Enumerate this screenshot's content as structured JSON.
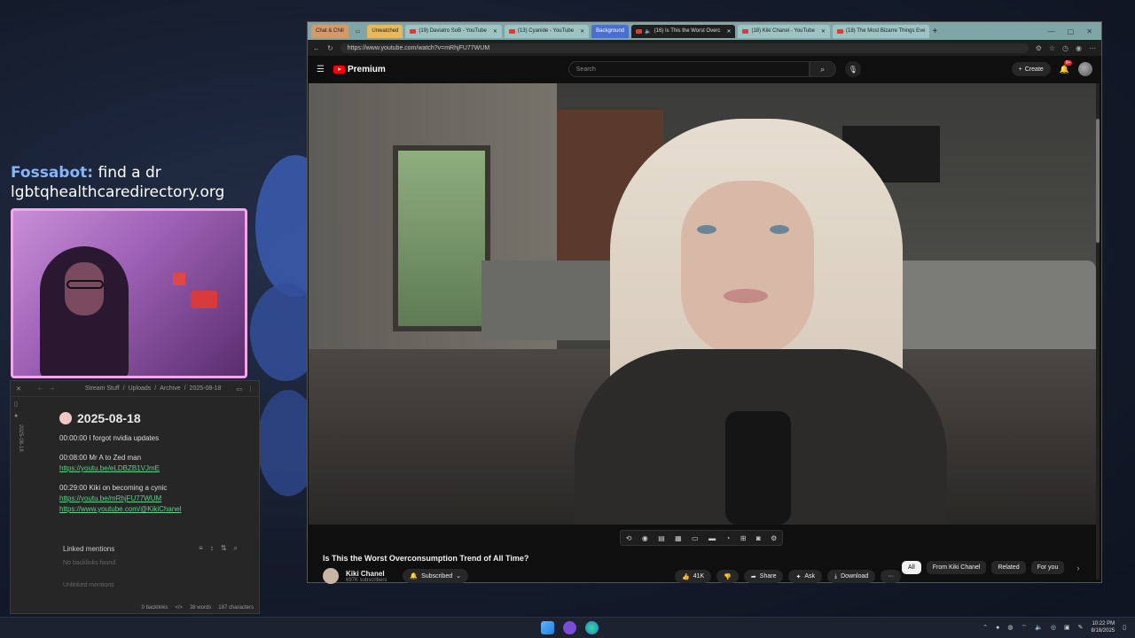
{
  "overlay": {
    "chat_user": "Fossabot:",
    "chat_message": "find a dr",
    "chat_link": "lgbtqhealthcaredirectory.org"
  },
  "obsidian": {
    "breadcrumb": [
      "Stream Stuff",
      "/",
      "Uploads",
      "/",
      "Archive",
      "/",
      "2025-08-18"
    ],
    "side_vertical": "2025-08-18",
    "title": "2025-08-18",
    "entries": [
      {
        "text": "00:00:00 I forgot nvidia updates",
        "links": []
      },
      {
        "text": "00:08:00 Mr A to Zed man",
        "links": [
          "https://youtu.be/eLDBZB1VJmE"
        ]
      },
      {
        "text": "00:29:00 Kiki on becoming a cynic",
        "links": [
          "https://youtu.be/mRhjFU77WUM",
          "https://www.youtube.com/@KikiChanel"
        ]
      }
    ],
    "linked_mentions": "Linked mentions",
    "no_backlinks": "No backlinks found.",
    "unlinked_mentions": "Unlinked mentions",
    "status": [
      "0 backlinks",
      "</>",
      "38 words",
      "187 characters"
    ]
  },
  "browser": {
    "tabs": [
      {
        "label": "Chat & Chill",
        "kind": "group-chat"
      },
      {
        "label": "",
        "kind": "page"
      },
      {
        "label": "Unwatched",
        "kind": "group-unw"
      },
      {
        "label": "(19) Daviatro SoB - YouTube",
        "kind": "tab"
      },
      {
        "label": "(13) Cyanide - YouTube",
        "kind": "tab"
      },
      {
        "label": "Background",
        "kind": "group-bg"
      },
      {
        "label": "(16) Is This the Worst Overc",
        "kind": "active"
      },
      {
        "label": "(18) Kiki Chanel - YouTube",
        "kind": "tab"
      },
      {
        "label": "(18) The Most Bizarre Things Eve",
        "kind": "tab"
      }
    ],
    "new_tab": "+",
    "url": "https://www.youtube.com/watch?v=mRhjFU77WUM"
  },
  "youtube": {
    "logo": "Premium",
    "search_placeholder": "Search",
    "create_label": "Create",
    "notif_count": "9+",
    "video_title": "Is This the Worst Overconsumption Trend of All Time?",
    "channel_name": "Kiki Chanel",
    "channel_subs": "697K subscribers",
    "subscribed_label": "Subscribed",
    "like_count": "41K",
    "share_label": "Share",
    "ask_label": "Ask",
    "download_label": "Download",
    "more_label": "···",
    "chips": [
      "All",
      "From Kiki Chanel",
      "Related",
      "For you"
    ]
  },
  "taskbar": {
    "time": "10:22 PM",
    "date": "8/18/2025"
  }
}
